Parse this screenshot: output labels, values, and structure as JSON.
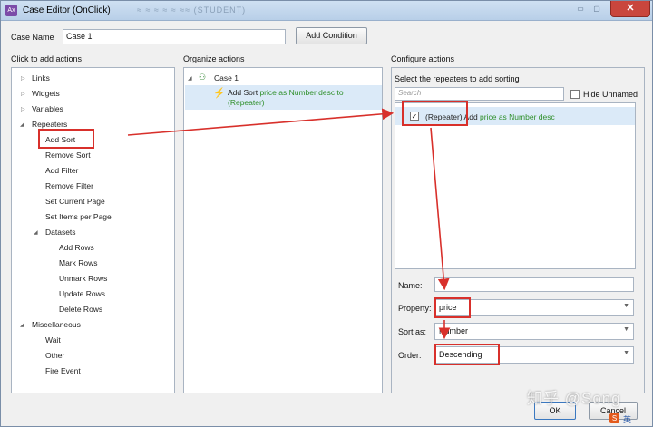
{
  "window": {
    "title": "Case Editor (OnClick)",
    "title_ghost": "≈ ≈ ≈ ≈ ≈  ≈≈ (STUDENT)",
    "close_label": "✕"
  },
  "case_name": {
    "label": "Case Name",
    "value": "Case 1",
    "add_condition_label": "Add Condition"
  },
  "left": {
    "header": "Click to add actions",
    "groups": [
      {
        "label": "Links"
      },
      {
        "label": "Widgets"
      },
      {
        "label": "Variables"
      },
      {
        "label": "Repeaters"
      }
    ],
    "repeater_items": [
      "Add Sort",
      "Remove Sort",
      "Add Filter",
      "Remove Filter",
      "Set Current Page",
      "Set Items per Page"
    ],
    "datasets_label": "Datasets",
    "dataset_items": [
      "Add Rows",
      "Mark Rows",
      "Unmark Rows",
      "Update Rows",
      "Delete Rows"
    ],
    "misc_label": "Miscellaneous",
    "misc_items": [
      "Wait",
      "Other",
      "Fire Event"
    ]
  },
  "middle": {
    "header": "Organize actions",
    "case_label": "Case 1",
    "action_prefix": "Add Sort",
    "action_detail": "price as Number desc to",
    "action_target": "(Repeater)"
  },
  "right": {
    "header": "Configure actions",
    "select_label": "Select the repeaters to add sorting",
    "search_placeholder": "Search",
    "hide_unnamed_label": "Hide Unnamed",
    "repeater_row": {
      "name": "(Repeater)",
      "action": "Add",
      "detail": "price as Number desc",
      "checked": true
    },
    "name_label": "Name:",
    "name_value": "",
    "property_label": "Property:",
    "property_value": "price",
    "sort_as_label": "Sort as:",
    "sort_as_value": "Number",
    "order_label": "Order:",
    "order_value": "Descending"
  },
  "footer": {
    "ok_label": "OK",
    "cancel_label": "Cancel"
  },
  "watermark": "知乎 @Song",
  "accent_color": "#d8302b",
  "action_green": "#2f8f2a"
}
